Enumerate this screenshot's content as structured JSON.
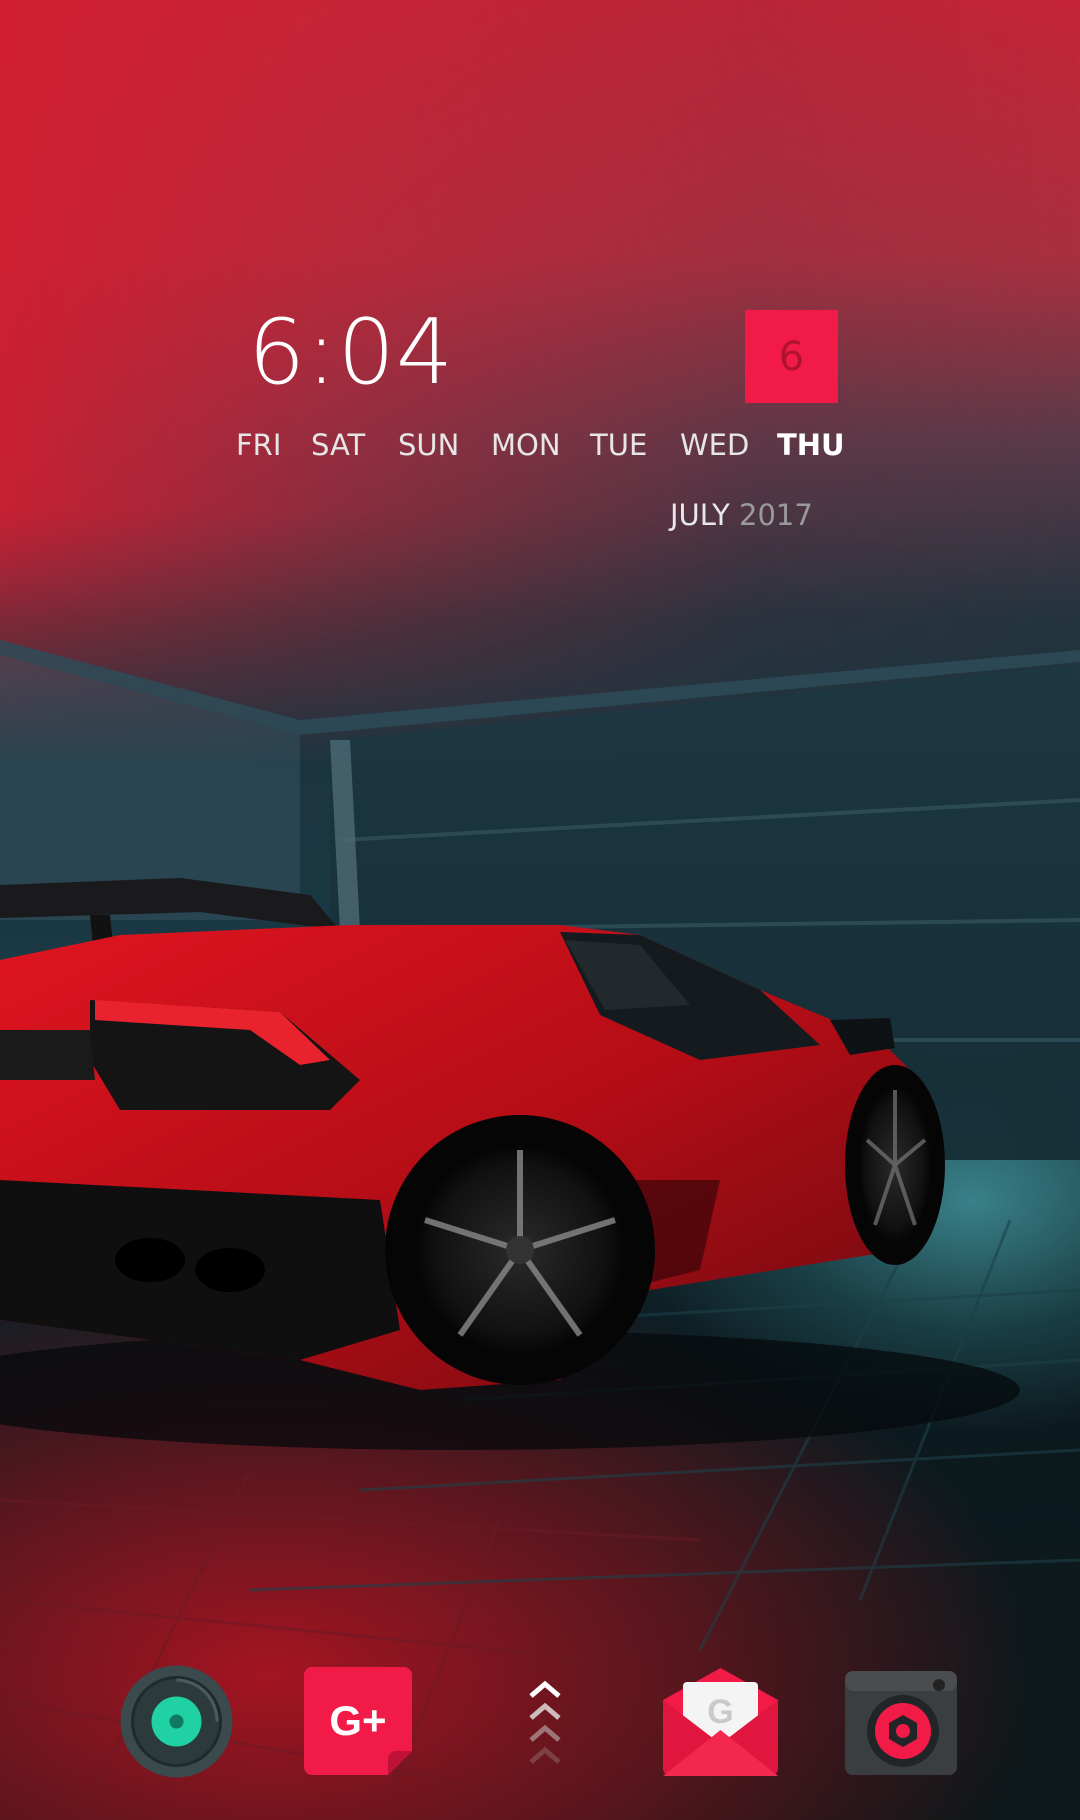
{
  "clock": {
    "time": "6:04",
    "day_number": "6",
    "weekdays": [
      "FRI",
      "SAT",
      "SUN",
      "MON",
      "TUE",
      "WED",
      "THU"
    ],
    "active_day_index": 6,
    "month": "JULY",
    "year": "2017"
  },
  "colors": {
    "accent": "#f21b47",
    "accent_dark": "#b0122f",
    "wallpaper_red": "#c52538",
    "wallpaper_teal": "#1a3a45"
  },
  "dock": {
    "icons": [
      {
        "name": "camera-toggle-icon",
        "label": ""
      },
      {
        "name": "google-plus-icon",
        "label": "G+"
      },
      {
        "name": "app-drawer-icon",
        "label": ""
      },
      {
        "name": "inbox-mail-icon",
        "label": "G"
      },
      {
        "name": "camera-icon",
        "label": ""
      }
    ]
  }
}
